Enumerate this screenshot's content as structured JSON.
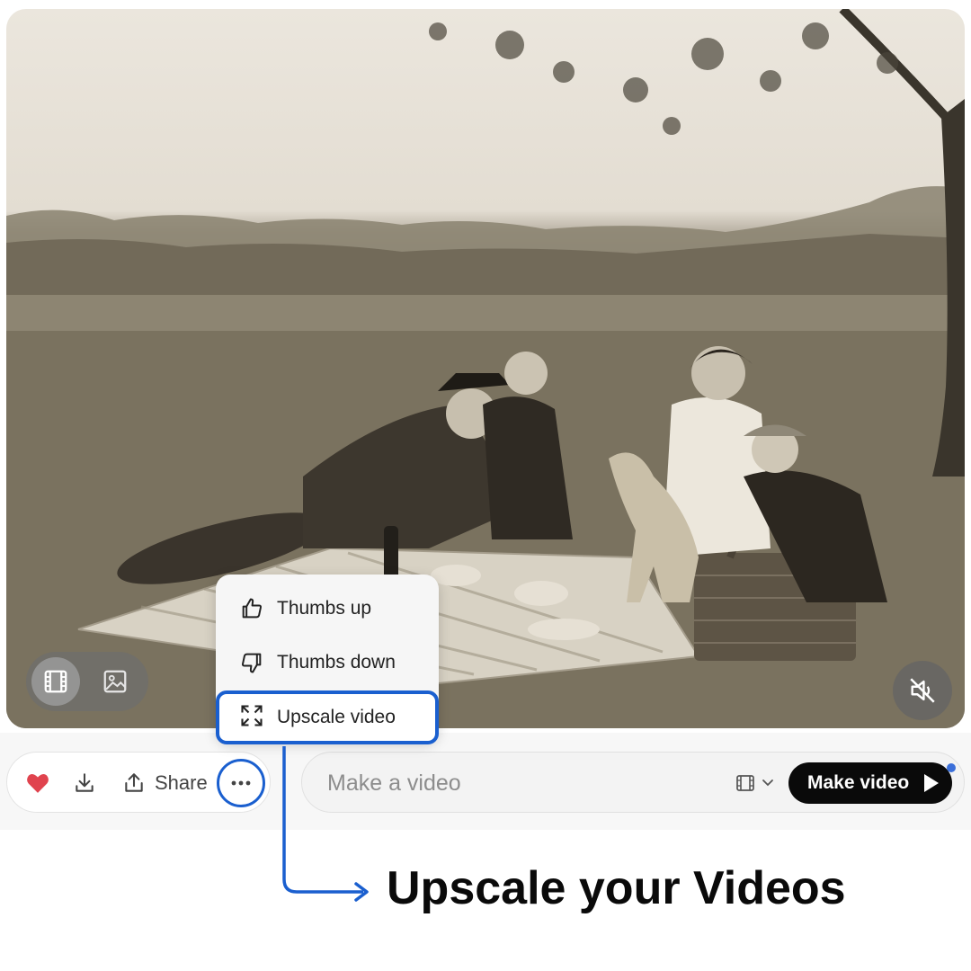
{
  "media": {
    "view_toggle": {
      "video_icon": "film-icon",
      "image_icon": "image-icon",
      "selected": "video"
    },
    "mute_icon": "volume-off-icon"
  },
  "toolbar": {
    "favorite_icon": "heart-icon",
    "favorite_color": "#e0434e",
    "download_icon": "download-icon",
    "share_label": "Share",
    "share_icon": "share-icon",
    "more_icon": "more-horizontal-icon"
  },
  "menu": {
    "items": [
      {
        "label": "Thumbs up",
        "icon": "thumbs-up-icon"
      },
      {
        "label": "Thumbs down",
        "icon": "thumbs-down-icon"
      },
      {
        "label": "Upscale video",
        "icon": "expand-icon",
        "highlighted": true
      }
    ]
  },
  "prompt": {
    "placeholder": "Make a video",
    "mode_icon": "film-icon",
    "submit_label": "Make video",
    "submit_icon": "play-icon"
  },
  "annotation": {
    "text": "Upscale your Videos",
    "accent_color": "#1a5fcf"
  }
}
